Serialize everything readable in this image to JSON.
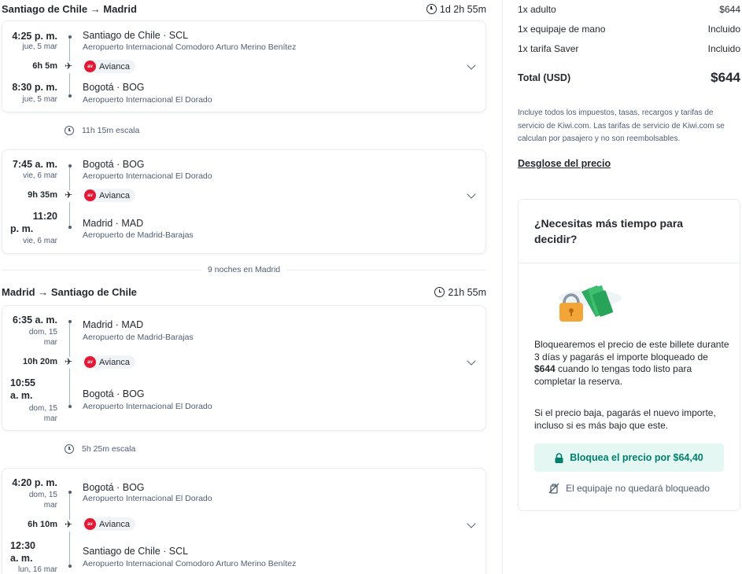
{
  "outbound": {
    "title": "Santiago de Chile → Madrid",
    "duration": "1d 2h 55m",
    "segments": [
      {
        "dep_time": "4:25 p. m.",
        "dep_date": "jue, 5 mar",
        "dep_station": "Santiago de Chile · SCL",
        "dep_airport": "Aeropuerto Internacional Comodoro Arturo Merino Benítez",
        "flight_duration": "6h 5m",
        "airline": "Avianca",
        "arr_time": "8:30 p. m.",
        "arr_date": "jue, 5 mar",
        "arr_station": "Bogotá · BOG",
        "arr_airport": "Aeropuerto Internacional El Dorado"
      },
      {
        "dep_time": "7:45 a. m.",
        "dep_date": "vie, 6 mar",
        "dep_station": "Bogotá · BOG",
        "dep_airport": "Aeropuerto Internacional El Dorado",
        "flight_duration": "9h 35m",
        "airline": "Avianca",
        "arr_time_1": "11:20",
        "arr_time_2": "p. m.",
        "arr_date": "vie, 6 mar",
        "arr_station": "Madrid · MAD",
        "arr_airport": "Aeropuerto de Madrid-Barajas"
      }
    ],
    "layover": "11h 15m escala"
  },
  "nights": "9 noches en Madrid",
  "inbound": {
    "title": "Madrid → Santiago de Chile",
    "duration": "21h 55m",
    "segments": [
      {
        "dep_time": "6:35 a. m.",
        "dep_date_1": "dom, 15",
        "dep_date_2": "mar",
        "dep_station": "Madrid · MAD",
        "dep_airport": "Aeropuerto de Madrid-Barajas",
        "flight_duration": "10h 20m",
        "airline": "Avianca",
        "arr_time_1": "10:55",
        "arr_time_2": "a. m.",
        "arr_date_1": "dom, 15",
        "arr_date_2": "mar",
        "arr_station": "Bogotá · BOG",
        "arr_airport": "Aeropuerto Internacional El Dorado"
      },
      {
        "dep_time": "4:20 p. m.",
        "dep_date_1": "dom, 15",
        "dep_date_2": "mar",
        "dep_station": "Bogotá · BOG",
        "dep_airport": "Aeropuerto Internacional El Dorado",
        "flight_duration": "6h 10m",
        "airline": "Avianca",
        "arr_time_1": "12:30",
        "arr_time_2": "a. m.",
        "arr_date": "lun, 16 mar",
        "arr_station": "Santiago de Chile · SCL",
        "arr_airport": "Aeropuerto Internacional Comodoro Arturo Merino Benítez"
      }
    ],
    "layover": "5h 25m escala"
  },
  "airline_logo_text": "av",
  "price": {
    "rows": [
      {
        "label": "1x adulto",
        "value": "$644"
      },
      {
        "label": "1x equipaje de mano",
        "value": "Incluido"
      },
      {
        "label": "1x tarifa Saver",
        "value": "Incluido"
      }
    ],
    "total_label": "Total (USD)",
    "total_value": "$644",
    "note": "Incluye todos los impuestos, tasas, recargos y tarifas de servicio de Kiwi.com. Las tarifas de servicio de Kiwi.com se calculan por pasajero y no son reembolsables.",
    "breakdown_link": "Desglose del precio"
  },
  "lock_card": {
    "title": "¿Necesitas más tiempo para decidir?",
    "text1_a": "Bloquearemos el precio de este billete durante 3 días y pagarás el importe bloqueado de ",
    "text1_bold": "$644",
    "text1_b": " cuando lo tengas todo listo para completar la reserva.",
    "text2": "Si el precio baja, pagarás el nuevo importe, incluso si es más bajo que este.",
    "button": "Bloquea el precio por $64,40",
    "baggage_note": "El equipaje no quedará bloqueado"
  },
  "colors": {
    "accent": "#007f6d",
    "accent_bg": "#e5f7f3",
    "airline": "#e31837",
    "text": "#252a31",
    "muted": "#4f5e71"
  }
}
